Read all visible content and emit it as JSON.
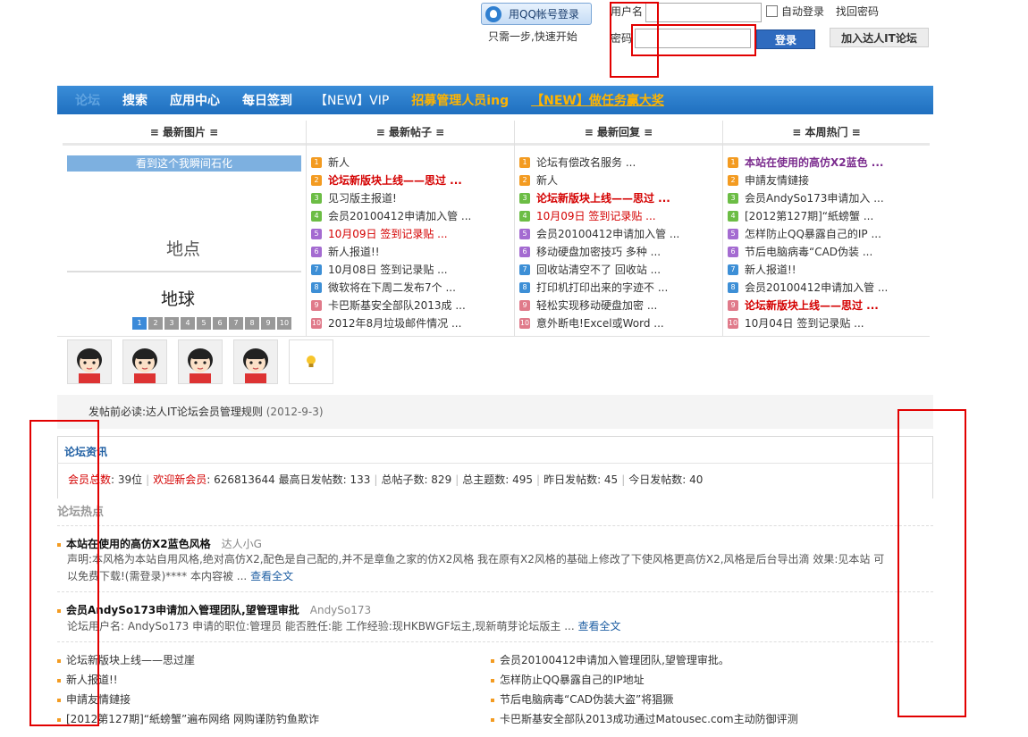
{
  "login": {
    "qq_button": "用QQ帐号登录",
    "tagline": "只需一步,快速开始",
    "username_label": "用户名",
    "password_label": "密码",
    "auto_login": "自动登录",
    "forgot": "找回密码",
    "login_button": "登录",
    "join_button": "加入达人IT论坛"
  },
  "nav": [
    "论坛",
    "搜索",
    "应用中心",
    "每日签到",
    "【NEW】VIP",
    "招募管理人员ing",
    "【NEW】做任务赢大奖"
  ],
  "columns": {
    "pics": "≡ 最新图片 ≡",
    "posts": "≡ 最新帖子 ≡",
    "replies": "≡ 最新回复 ≡",
    "hot": "≡ 本周热门 ≡"
  },
  "slider": {
    "caption": "看到这个我瞬间石化",
    "text1": "地点",
    "text2": "地球",
    "pages": [
      "1",
      "2",
      "3",
      "4",
      "5",
      "6",
      "7",
      "8",
      "9",
      "10"
    ]
  },
  "latest_posts": [
    {
      "n": "1",
      "text": "新人",
      "style": ""
    },
    {
      "n": "2",
      "text": "论坛新版块上线——思过 ...",
      "style": "red"
    },
    {
      "n": "3",
      "text": "见习版主报道!",
      "style": ""
    },
    {
      "n": "4",
      "text": "会员20100412申请加入管 ...",
      "style": ""
    },
    {
      "n": "5",
      "text": "10月09日 签到记录贴 ...",
      "style": "redn"
    },
    {
      "n": "6",
      "text": "新人报道!!",
      "style": ""
    },
    {
      "n": "7",
      "text": "10月08日 签到记录贴 ...",
      "style": ""
    },
    {
      "n": "8",
      "text": "微软将在下周二发布7个 ...",
      "style": ""
    },
    {
      "n": "9",
      "text": "卡巴斯基安全部队2013成 ...",
      "style": ""
    },
    {
      "n": "10",
      "text": "2012年8月垃圾邮件情况 ...",
      "style": ""
    }
  ],
  "latest_replies": [
    {
      "n": "1",
      "text": "论坛有偿改名服务 ...",
      "style": ""
    },
    {
      "n": "2",
      "text": "新人",
      "style": ""
    },
    {
      "n": "3",
      "text": "论坛新版块上线——思过 ...",
      "style": "red"
    },
    {
      "n": "4",
      "text": "10月09日 签到记录贴 ...",
      "style": "redn"
    },
    {
      "n": "5",
      "text": "会员20100412申请加入管 ...",
      "style": ""
    },
    {
      "n": "6",
      "text": "移动硬盘加密技巧 多种 ...",
      "style": ""
    },
    {
      "n": "7",
      "text": "回收站清空不了 回收站 ...",
      "style": ""
    },
    {
      "n": "8",
      "text": "打印机打印出来的字迹不 ...",
      "style": ""
    },
    {
      "n": "9",
      "text": "轻松实现移动硬盘加密 ...",
      "style": ""
    },
    {
      "n": "10",
      "text": "意外断电!Excel或Word ...",
      "style": ""
    }
  ],
  "weekly_hot": [
    {
      "n": "1",
      "text": "本站在使用的高仿X2蓝色 ...",
      "style": "purple"
    },
    {
      "n": "2",
      "text": "申請友情鏈接",
      "style": ""
    },
    {
      "n": "3",
      "text": "会员AndySo173申请加入 ...",
      "style": ""
    },
    {
      "n": "4",
      "text": "[2012第127期]“紙螃蟹 ...",
      "style": ""
    },
    {
      "n": "5",
      "text": "怎样防止QQ暴露自己的IP ...",
      "style": ""
    },
    {
      "n": "6",
      "text": "节后电脑病毒“CAD伪装 ...",
      "style": ""
    },
    {
      "n": "7",
      "text": "新人报道!!",
      "style": ""
    },
    {
      "n": "8",
      "text": "会员20100412申请加入管 ...",
      "style": ""
    },
    {
      "n": "9",
      "text": "论坛新版块上线——思过 ...",
      "style": "red"
    },
    {
      "n": "10",
      "text": "10月04日 签到记录贴 ...",
      "style": ""
    }
  ],
  "notice": {
    "text": "发帖前必读:达人IT论坛会员管理规则",
    "date": "(2012-9-3)"
  },
  "stats": {
    "title": "论坛资讯",
    "members_label": "会员总数",
    "members_value": ": 39位",
    "welcome_label": "欢迎新会员",
    "welcome_value": ": 626813644",
    "max_daily": "最高日发帖数: 133",
    "total_posts": "总帖子数: 829",
    "total_topics": "总主题数: 495",
    "yesterday": "昨日发帖数: 45",
    "today": "今日发帖数: 40"
  },
  "hot_section": {
    "title": "论坛热点",
    "items": [
      {
        "title": "本站在使用的高仿X2蓝色风格",
        "author": "达人小G",
        "desc1": "声明:本风格为本站自用风格,绝对高仿X2,配色是自己配的,并不是章鱼之家的仿X2风格 我在原有X2风格的基础上修改了下使风格更高仿X2,风格是后台导出滴 效果:见本站 可",
        "desc2": "以免费下载!(需登录)**** 本内容被 ... ",
        "more": "查看全文"
      },
      {
        "title": "会员AndySo173申请加入管理团队,望管理审批",
        "author": "AndySo173",
        "desc1": "论坛用户名: AndySo173 申请的职位:管理员 能否胜任:能 工作经验:现HKBWGF坛主,现新萌芽论坛版主 ... ",
        "more": "查看全文"
      }
    ],
    "left_list": [
      "论坛新版块上线——思过崖",
      "新人报道!!",
      "申請友情鏈接",
      "[2012第127期]“紙螃蟹”遍布网络 网购谨防钓鱼欺诈"
    ],
    "right_list": [
      "会员20100412申请加入管理团队,望管理审批。",
      "怎样防止QQ暴露自己的IP地址",
      "节后电脑病毒“CAD伪装大盗”将猖獗",
      "卡巴斯基安全部队2013成功通过Matousec.com主动防御评测"
    ]
  }
}
